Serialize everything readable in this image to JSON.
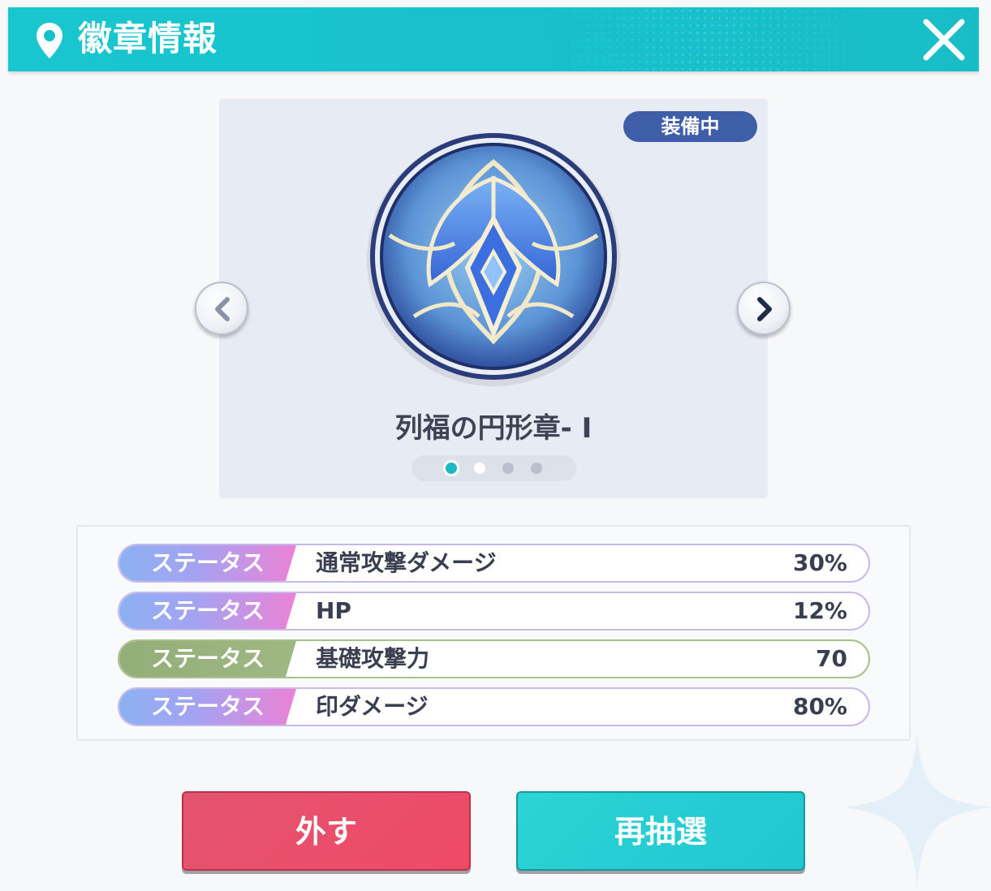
{
  "header": {
    "title": "徽章情報",
    "close_label": "✕"
  },
  "card": {
    "status_badge": "装備中",
    "emblem_name": "列福の円形章- I",
    "page_count": 4,
    "current_page": 1
  },
  "stats": [
    {
      "tag": "ステータス",
      "name": "通常攻撃ダメージ",
      "value": "30%",
      "tag_color": "pink"
    },
    {
      "tag": "ステータス",
      "name": "HP",
      "value": "12%",
      "tag_color": "pink"
    },
    {
      "tag": "ステータス",
      "name": "基礎攻撃力",
      "value": "70",
      "tag_color": "green"
    },
    {
      "tag": "ステータス",
      "name": "印ダメージ",
      "value": "80%",
      "tag_color": "pink"
    }
  ],
  "buttons": {
    "remove_label": "外す",
    "reroll_label": "再抽選"
  },
  "colors": {
    "header": "#19c6d0",
    "badge": "#3e5ea9",
    "remove": "#e84e68",
    "reroll": "#23cdd3",
    "tag_pink": "#ec82d6",
    "tag_green": "#9fb883"
  }
}
